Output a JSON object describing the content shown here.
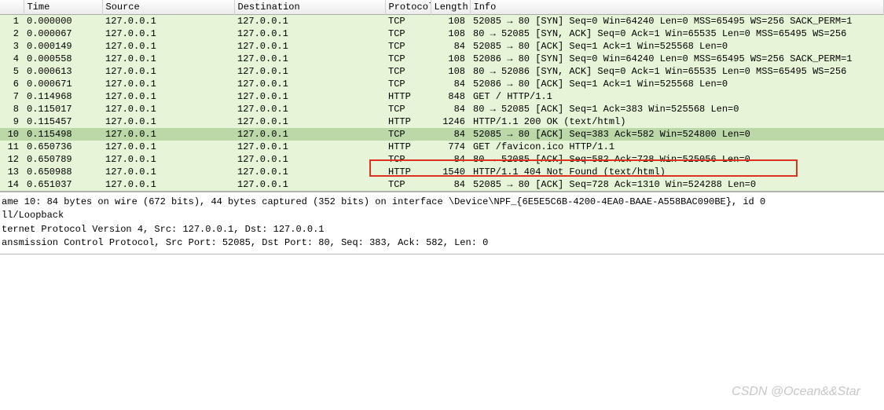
{
  "columns": {
    "no": "",
    "time": "Time",
    "source": "Source",
    "destination": "Destination",
    "protocol": "Protocol",
    "length": "Length",
    "info": "Info"
  },
  "packets": [
    {
      "no": "1",
      "time": "0.000000",
      "src": "127.0.0.1",
      "dst": "127.0.0.1",
      "proto": "TCP",
      "len": "108",
      "info": "52085 → 80 [SYN] Seq=0 Win=64240 Len=0 MSS=65495 WS=256 SACK_PERM=1"
    },
    {
      "no": "2",
      "time": "0.000067",
      "src": "127.0.0.1",
      "dst": "127.0.0.1",
      "proto": "TCP",
      "len": "108",
      "info": "80 → 52085 [SYN, ACK] Seq=0 Ack=1 Win=65535 Len=0 MSS=65495 WS=256"
    },
    {
      "no": "3",
      "time": "0.000149",
      "src": "127.0.0.1",
      "dst": "127.0.0.1",
      "proto": "TCP",
      "len": "84",
      "info": "52085 → 80 [ACK] Seq=1 Ack=1 Win=525568 Len=0"
    },
    {
      "no": "4",
      "time": "0.000558",
      "src": "127.0.0.1",
      "dst": "127.0.0.1",
      "proto": "TCP",
      "len": "108",
      "info": "52086 → 80 [SYN] Seq=0 Win=64240 Len=0 MSS=65495 WS=256 SACK_PERM=1"
    },
    {
      "no": "5",
      "time": "0.000613",
      "src": "127.0.0.1",
      "dst": "127.0.0.1",
      "proto": "TCP",
      "len": "108",
      "info": "80 → 52086 [SYN, ACK] Seq=0 Ack=1 Win=65535 Len=0 MSS=65495 WS=256"
    },
    {
      "no": "6",
      "time": "0.000671",
      "src": "127.0.0.1",
      "dst": "127.0.0.1",
      "proto": "TCP",
      "len": "84",
      "info": "52086 → 80 [ACK] Seq=1 Ack=1 Win=525568 Len=0"
    },
    {
      "no": "7",
      "time": "0.114968",
      "src": "127.0.0.1",
      "dst": "127.0.0.1",
      "proto": "HTTP",
      "len": "848",
      "info": "GET / HTTP/1.1"
    },
    {
      "no": "8",
      "time": "0.115017",
      "src": "127.0.0.1",
      "dst": "127.0.0.1",
      "proto": "TCP",
      "len": "84",
      "info": "80 → 52085 [ACK] Seq=1 Ack=383 Win=525568 Len=0"
    },
    {
      "no": "9",
      "time": "0.115457",
      "src": "127.0.0.1",
      "dst": "127.0.0.1",
      "proto": "HTTP",
      "len": "1246",
      "info": "HTTP/1.1 200 OK  (text/html)"
    },
    {
      "no": "10",
      "time": "0.115498",
      "src": "127.0.0.1",
      "dst": "127.0.0.1",
      "proto": "TCP",
      "len": "84",
      "info": "52085 → 80 [ACK] Seq=383 Ack=582 Win=524800 Len=0",
      "selected": true
    },
    {
      "no": "11",
      "time": "0.650736",
      "src": "127.0.0.1",
      "dst": "127.0.0.1",
      "proto": "HTTP",
      "len": "774",
      "info": "GET /favicon.ico HTTP/1.1"
    },
    {
      "no": "12",
      "time": "0.650789",
      "src": "127.0.0.1",
      "dst": "127.0.0.1",
      "proto": "TCP",
      "len": "84",
      "info": "80 → 52085 [ACK] Seq=582 Ack=728 Win=525056 Len=0"
    },
    {
      "no": "13",
      "time": "0.650988",
      "src": "127.0.0.1",
      "dst": "127.0.0.1",
      "proto": "HTTP",
      "len": "1540",
      "info": "HTTP/1.1 404 Not Found  (text/html)"
    },
    {
      "no": "14",
      "time": "0.651037",
      "src": "127.0.0.1",
      "dst": "127.0.0.1",
      "proto": "TCP",
      "len": "84",
      "info": "52085 → 80 [ACK] Seq=728 Ack=1310 Win=524288 Len=0"
    }
  ],
  "details": {
    "line1": "ame 10: 84 bytes on wire (672 bits), 44 bytes captured (352 bits) on interface \\Device\\NPF_{6E5E5C6B-4200-4EA0-BAAE-A558BAC090BE}, id 0",
    "line2": "ll/Loopback",
    "line3": "ternet Protocol Version 4, Src: 127.0.0.1, Dst: 127.0.0.1",
    "line4": "ansmission Control Protocol, Src Port: 52085, Dst Port: 80, Seq: 383, Ack: 582, Len: 0"
  },
  "watermark": "CSDN @Ocean&&Star"
}
